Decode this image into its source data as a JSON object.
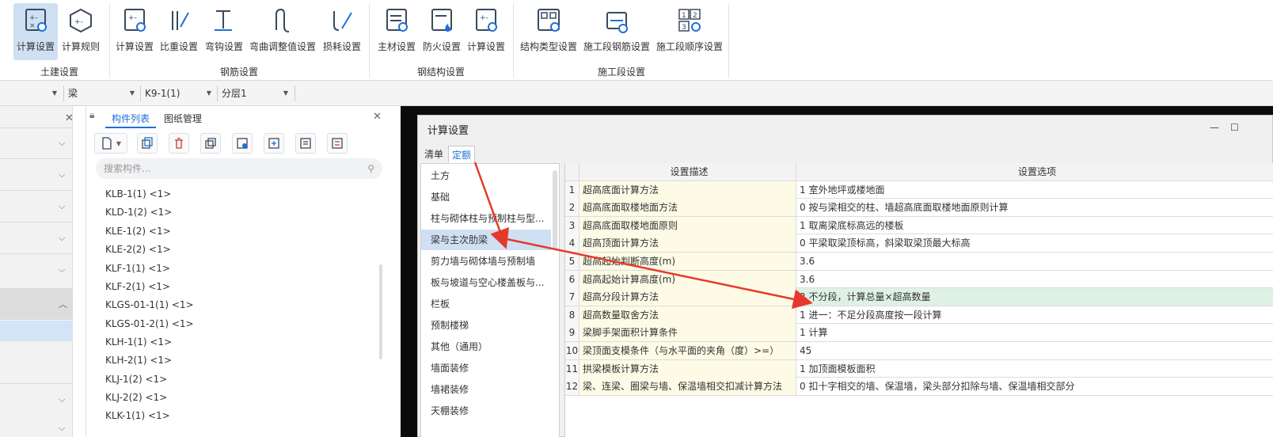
{
  "ribbon": {
    "groups": [
      {
        "label": "土建设置",
        "buttons": [
          {
            "label": "计算设置",
            "icon": "calc-settings-icon",
            "active": true
          },
          {
            "label": "计算规则",
            "icon": "calc-rules-icon"
          }
        ]
      },
      {
        "label": "钢筋设置",
        "buttons": [
          {
            "label": "计算设置",
            "icon": "calc-settings-icon"
          },
          {
            "label": "比重设置",
            "icon": "density-settings-icon"
          },
          {
            "label": "弯钩设置",
            "icon": "hook-settings-icon"
          },
          {
            "label": "弯曲调整值设置",
            "icon": "bend-adjust-icon"
          },
          {
            "label": "损耗设置",
            "icon": "loss-settings-icon"
          }
        ]
      },
      {
        "label": "钢结构设置",
        "buttons": [
          {
            "label": "主材设置",
            "icon": "main-material-icon"
          },
          {
            "label": "防火设置",
            "icon": "fireproof-icon"
          },
          {
            "label": "计算设置",
            "icon": "calc-settings-icon"
          }
        ]
      },
      {
        "label": "施工段设置",
        "buttons": [
          {
            "label": "结构类型设置",
            "icon": "structure-type-icon"
          },
          {
            "label": "施工段钢筋设置",
            "icon": "segment-rebar-icon"
          },
          {
            "label": "施工段顺序设置",
            "icon": "segment-order-icon"
          }
        ]
      }
    ]
  },
  "selectors": {
    "component_type": "梁",
    "component": "K9-1(1)",
    "layer": "分层1"
  },
  "component_panel": {
    "tabs": [
      "构件列表",
      "图纸管理"
    ],
    "search_placeholder": "搜索构件...",
    "items": [
      "KLB-1(1) <1>",
      "KLD-1(2) <1>",
      "KLE-1(2) <1>",
      "KLE-2(2) <1>",
      "KLF-1(1) <1>",
      "KLF-2(1) <1>",
      "KLGS-01-1(1) <1>",
      "KLGS-01-2(1) <1>",
      "KLH-1(1) <1>",
      "KLH-2(1) <1>",
      "KLJ-1(2) <1>",
      "KLJ-2(2) <1>",
      "KLK-1(1) <1>"
    ]
  },
  "dialog": {
    "title": "计算设置",
    "tabs": [
      "清单",
      "定额"
    ],
    "active_tab": "定额",
    "categories": [
      "土方",
      "基础",
      "柱与砌体柱与预制柱与型...",
      "梁与主次肋梁",
      "剪力墙与砌体墙与预制墙",
      "板与坡道与空心楼盖板与...",
      "栏板",
      "预制楼梯",
      "其他（通用）",
      "墙面装修",
      "墙裙装修",
      "天棚装修"
    ],
    "selected_category": "梁与主次肋梁",
    "table": {
      "headers": [
        "设置描述",
        "设置选项"
      ],
      "rows": [
        {
          "no": "1",
          "desc": "超高底面计算方法",
          "opt": "1 室外地坪或楼地面"
        },
        {
          "no": "2",
          "desc": "超高底面取楼地面方法",
          "opt": "0 按与梁相交的柱、墙超高底面取楼地面原则计算"
        },
        {
          "no": "3",
          "desc": "超高底面取楼地面原则",
          "opt": "1 取离梁底标高远的楼板"
        },
        {
          "no": "4",
          "desc": "超高顶面计算方法",
          "opt": "0 平梁取梁顶标高，斜梁取梁顶最大标高"
        },
        {
          "no": "5",
          "desc": "超高起始判断高度(m)",
          "opt": "3.6"
        },
        {
          "no": "6",
          "desc": "超高起始计算高度(m)",
          "opt": "3.6"
        },
        {
          "no": "7",
          "desc": "超高分段计算方法",
          "opt": "2 不分段，计算总量×超高数量"
        },
        {
          "no": "8",
          "desc": "超高数量取舍方法",
          "opt": "1 进一：不足分段高度按一段计算"
        },
        {
          "no": "9",
          "desc": "梁脚手架面积计算条件",
          "opt": "1 计算"
        },
        {
          "no": "10",
          "desc": "梁顶面支模条件（与水平面的夹角（度）>=）",
          "opt": "45"
        },
        {
          "no": "11",
          "desc": "拱梁模板计算方法",
          "opt": "1 加顶面模板面积"
        },
        {
          "no": "12",
          "desc": "梁、连梁、圈梁与墙、保温墙相交扣减计算方法",
          "opt": "0 扣十字相交的墙、保温墙，梁头部分扣除与墙、保温墙相交部分"
        }
      ],
      "highlighted_row": "7"
    }
  },
  "colors": {
    "accent": "#1e6fd9",
    "annotation_arrow": "#e53a2b",
    "row_highlight": "#dff1e4"
  }
}
